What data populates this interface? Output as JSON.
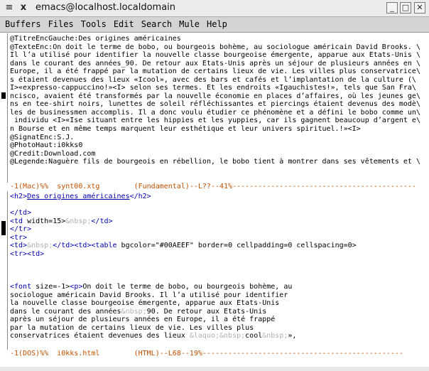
{
  "titlebar": {
    "title": "emacs@localhost.localdomain",
    "menu_glyph": "≡",
    "min": "_",
    "max": "□",
    "close": "✕"
  },
  "menubar": {
    "items": [
      "Buffers",
      "Files",
      "Tools",
      "Edit",
      "Search",
      "Mule",
      "Help"
    ]
  },
  "top_buffer": {
    "lines": [
      "@TitreEncGauche:Des origines américaines",
      "@TexteEnc:On doit le terme de bobo, ou bourgeois bohème, au sociologue américain David Brooks. \\",
      "Il l’a utilisé pour identifier la nouvelle classe bourgeoise émergente, apparue aux Etats-Unis \\",
      "dans le courant des années_90. De retour aux Etats-Unis après un séjour de plusieurs années en \\",
      "Europe, il a été frappé par la mutation de certains lieux de vie. Les villes plus conservatrice\\",
      "s étaient devenues des lieux «Icool», avec des bars et cafés et l’implantation de la culture (\\",
      "I>«expresso-cappuccino!»<I> selon ses termes. Et les endroits «Igauchistes!», tels que San Fra\\",
      "ncisco, avaient été transformés par la nouvelle économie en places d’affaires, où les jeunes ge\\",
      "ns en tee-shirt noirs, lunettes de soleil réfléchissantes et piercings étaient devenus des modè\\",
      "les de businessmen accomplis. Il a donc voulu étudier ce phénomène et a défini le bobo comme un\\",
      " individu <I>«Ise situant entre les hippies et les yuppies, car ils gagnent beaucoup d’argent e\\",
      "n Bourse et en même temps marquent leur esthétique et leur univers spirituel.!»<I>",
      "@SignatEnc:S.J.",
      "@PhotoHaut:i0kks0",
      "@Credit:Download.com",
      "@Legende:Naguère fils de bourgeois en rébellion, le bobo tient à montrer dans ses vêtements et \\"
    ],
    "modeline": "-1(Mac)%%  synt00.xtg        (Fundamental)--L??--41%-------------------------------------------"
  },
  "bottom_buffer": {
    "l1_open": "<h2>",
    "l1_title": "Des origines américaines",
    "l1_close": "</h2>",
    "l3": "</td>",
    "l4_a": "<td",
    "l4_b": " width=15>",
    "l4_ent": "&nbsp;",
    "l4_c": "</td>",
    "l5": "</tr>",
    "l6": "<tr>",
    "l7_a": "<td>",
    "l7_ent": "&nbsp;",
    "l7_b": "</td><td><table",
    "l7_c": " bgcolor=",
    "l7_str": "\"#00AEEF\"",
    "l7_d": " border=0 cellpadding=0 cellspacing=0>",
    "l8": "<tr><td>",
    "l12_a": "<font",
    "l12_b": " size=-1>",
    "l12_c": "<p>",
    "l12_d": "On doit le terme de bobo, ou bourgeois bohème, au",
    "l13": "sociologue américain David Brooks. Il l’a utilisé pour identifier",
    "l14": "la nouvelle classe bourgeoise émergente, apparue aux Etats-Unis",
    "l15_a": "dans le courant des années",
    "l15_ent": "&nbsp;",
    "l15_b": "90. De retour aux Etats-Unis",
    "l16": "après un séjour de plusieurs années en Europe, il a été frappé",
    "l17": "par la mutation de certains lieux de vie. Les villes plus",
    "l18_a": "conservatrices étaient devenues des lieux ",
    "l18_ent1": "&laquo;&nbsp;",
    "l18_b": "cool",
    "l18_ent2": "&nbsp;",
    "l18_c": "»,",
    "modeline": "-1(DOS)%%  i0kks.html        (HTML)--L68--19%-----------------------------------------------"
  }
}
